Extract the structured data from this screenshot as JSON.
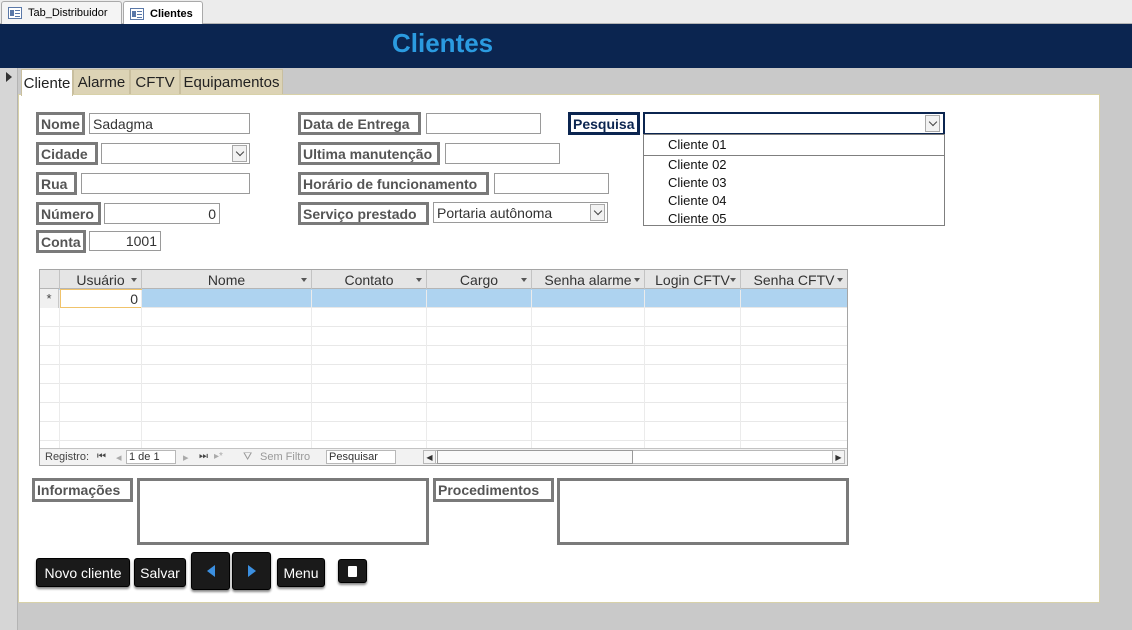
{
  "doc_tabs": [
    {
      "label": "Tab_Distribuidor",
      "active": false
    },
    {
      "label": "Clientes",
      "active": true
    }
  ],
  "header": {
    "title": "Clientes"
  },
  "form_tabs": [
    "Cliente",
    "Alarme",
    "CFTV",
    "Equipamentos"
  ],
  "fields": {
    "nome": {
      "label": "Nome",
      "value": "Sadagma"
    },
    "cidade": {
      "label": "Cidade",
      "value": ""
    },
    "rua": {
      "label": "Rua",
      "value": ""
    },
    "numero": {
      "label": "Número",
      "value": "0"
    },
    "conta": {
      "label": "Conta",
      "value": "1001"
    },
    "data_entrega": {
      "label": "Data de Entrega",
      "value": ""
    },
    "ultima_manutencao": {
      "label": "Ultima manutenção",
      "value": ""
    },
    "horario": {
      "label": "Horário de funcionamento",
      "value": ""
    },
    "servico": {
      "label": "Serviço prestado",
      "value": "Portaria autônoma"
    },
    "pesquisa": {
      "label": "Pesquisa",
      "value": ""
    }
  },
  "pesquisa_options": [
    "Cliente 01",
    "Cliente 02",
    "Cliente 03",
    "Cliente 04",
    "Cliente 05"
  ],
  "grid": {
    "columns": [
      "Usuário",
      "Nome",
      "Contato",
      "Cargo",
      "Senha alarme",
      "Login CFTV",
      "Senha CFTV"
    ],
    "new_row_marker": "*",
    "new_row_value": "0",
    "nav": {
      "label": "Registro:",
      "position": "1 de 1",
      "filter": "Sem Filtro",
      "search": "Pesquisar"
    }
  },
  "memo": {
    "informacoes": "Informações",
    "procedimentos": "Procedimentos"
  },
  "buttons": {
    "novo_cliente": "Novo cliente",
    "salvar": "Salvar",
    "menu": "Menu"
  },
  "colors": {
    "header_bg": "#0b2550",
    "header_title": "#2b9be0",
    "tab_bg": "#dcd3b5",
    "grid_new_row": "#aed3f0"
  }
}
